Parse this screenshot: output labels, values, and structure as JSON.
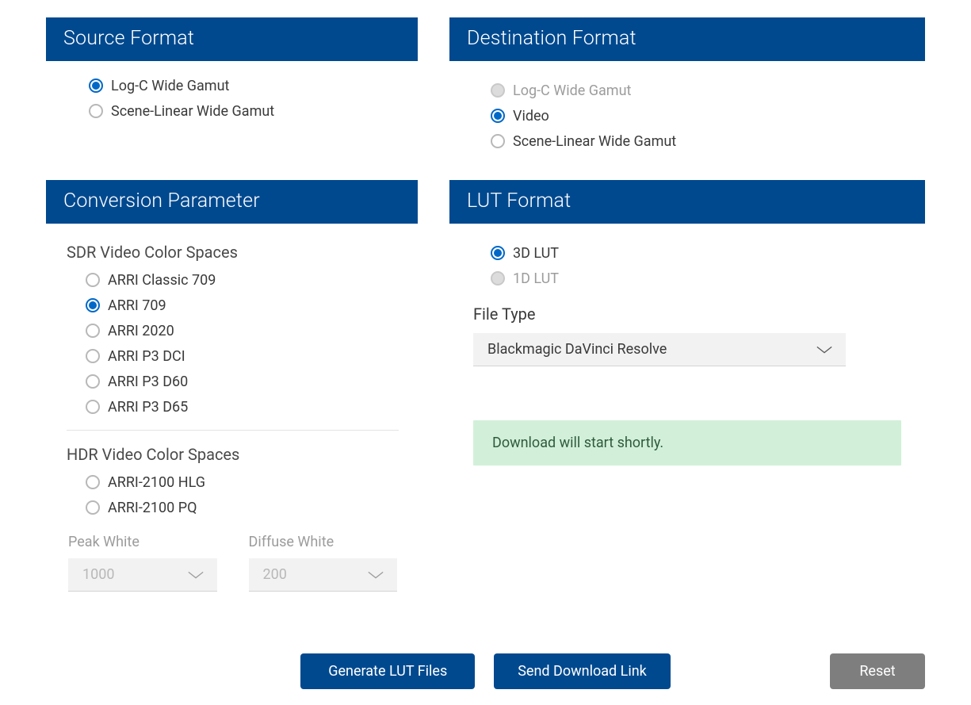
{
  "source_format": {
    "title": "Source Format",
    "options": [
      {
        "label": "Log-C Wide Gamut",
        "selected": true,
        "disabled": false
      },
      {
        "label": "Scene-Linear Wide Gamut",
        "selected": false,
        "disabled": false
      }
    ]
  },
  "destination_format": {
    "title": "Destination Format",
    "options": [
      {
        "label": "Log-C Wide Gamut",
        "selected": false,
        "disabled": true
      },
      {
        "label": "Video",
        "selected": true,
        "disabled": false
      },
      {
        "label": "Scene-Linear Wide Gamut",
        "selected": false,
        "disabled": false
      }
    ]
  },
  "conversion": {
    "title": "Conversion Parameter",
    "sdr_label": "SDR Video Color Spaces",
    "sdr_options": [
      {
        "label": "ARRI Classic 709",
        "selected": false
      },
      {
        "label": "ARRI 709",
        "selected": true
      },
      {
        "label": "ARRI 2020",
        "selected": false
      },
      {
        "label": "ARRI P3 DCI",
        "selected": false
      },
      {
        "label": "ARRI P3 D60",
        "selected": false
      },
      {
        "label": "ARRI P3 D65",
        "selected": false
      }
    ],
    "hdr_label": "HDR Video Color Spaces",
    "hdr_options": [
      {
        "label": "ARRI-2100 HLG",
        "selected": false
      },
      {
        "label": "ARRI-2100 PQ",
        "selected": false
      }
    ],
    "peak_white_label": "Peak White",
    "peak_white_value": "1000",
    "diffuse_white_label": "Diffuse White",
    "diffuse_white_value": "200"
  },
  "lut_format": {
    "title": "LUT Format",
    "options": [
      {
        "label": "3D LUT",
        "selected": true,
        "disabled": false
      },
      {
        "label": "1D LUT",
        "selected": false,
        "disabled": true
      }
    ],
    "file_type_label": "File Type",
    "file_type_value": "Blackmagic DaVinci Resolve"
  },
  "notice": "Download will start shortly.",
  "buttons": {
    "generate": "Generate LUT Files",
    "send_link": "Send Download Link",
    "reset": "Reset"
  }
}
